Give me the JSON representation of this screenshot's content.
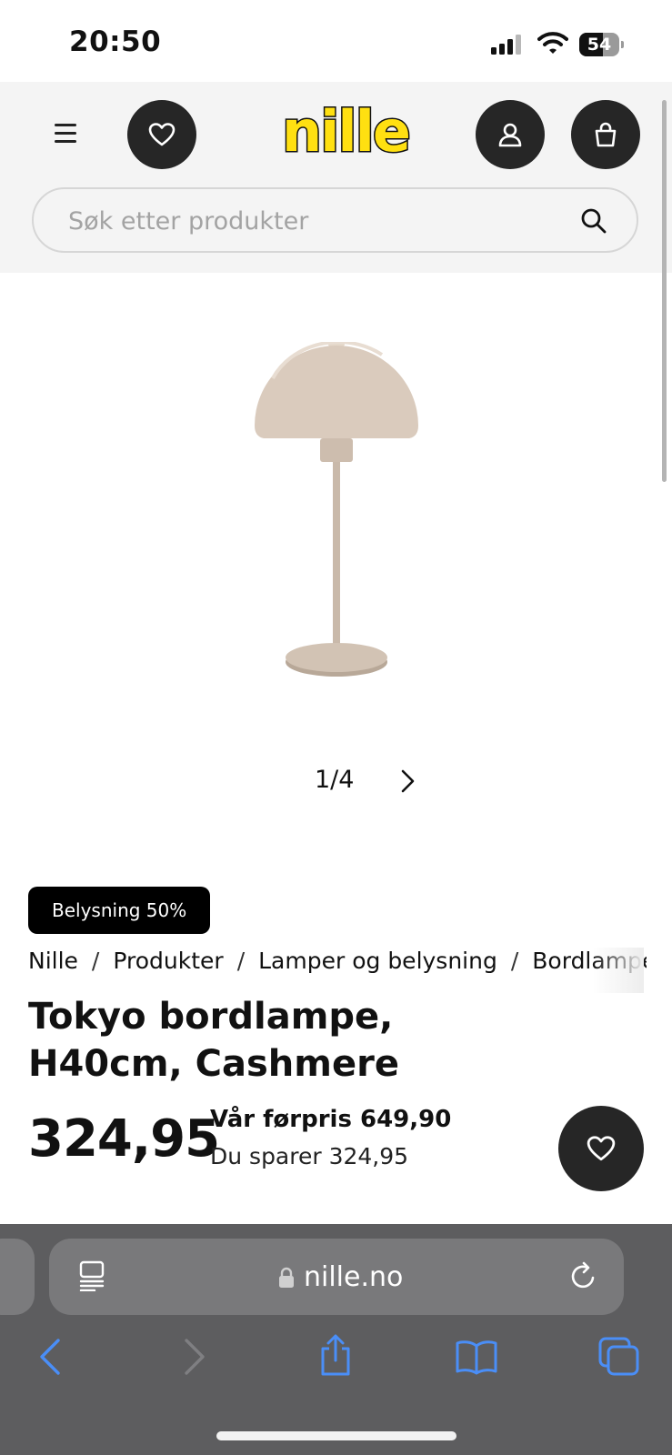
{
  "status_bar": {
    "time": "20:50",
    "battery": "54"
  },
  "header": {
    "logo": "nille",
    "search_placeholder": "Søk etter produkter"
  },
  "gallery": {
    "pager": "1/4"
  },
  "product": {
    "badge": "Belysning 50%",
    "breadcrumb": [
      "Nille",
      "Produkter",
      "Lamper og belysning",
      "Bordlamper"
    ],
    "title_line1": "Tokyo bordlampe,",
    "title_line2": "H40cm, Cashmere",
    "price": "324,95",
    "previous_price": "Vår førpris 649,90",
    "savings": "Du sparer 324,95"
  },
  "browser": {
    "url": "nille.no"
  },
  "colors": {
    "accent_dark": "#262626",
    "logo_yellow": "#ffe011",
    "browser_blue": "#4a8ef7",
    "lamp_color": "#d9cbbb"
  }
}
